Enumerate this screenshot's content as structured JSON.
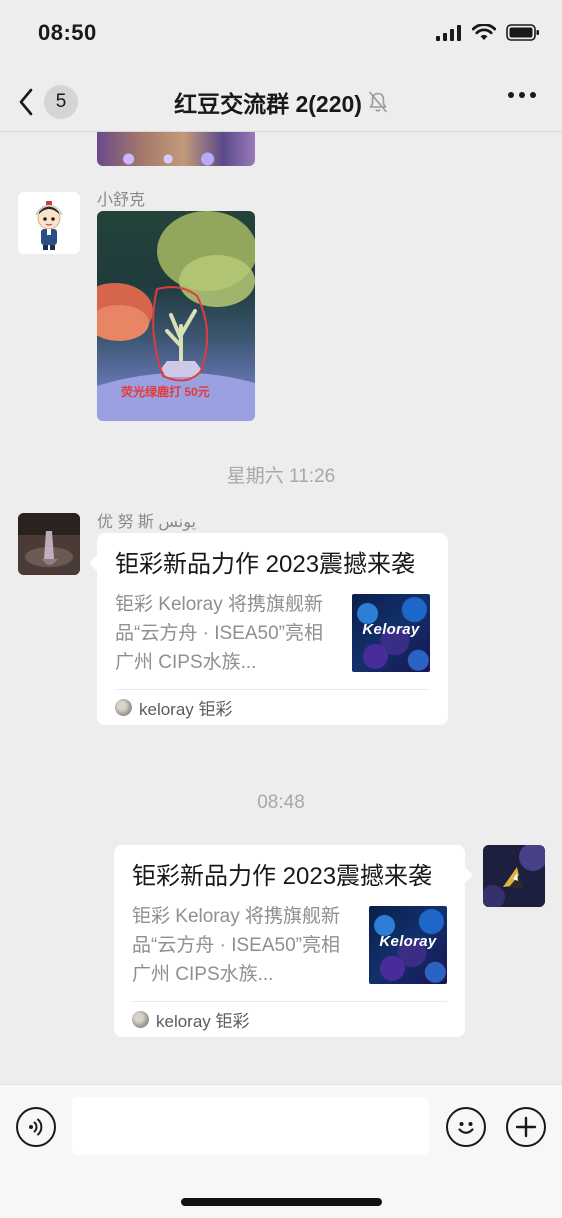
{
  "status_bar": {
    "time": "08:50"
  },
  "nav": {
    "unread_count": "5",
    "title": "红豆交流群 2(220)"
  },
  "messages": {
    "msg1": {
      "sender": "小舒克",
      "image_caption": "荧光绿鹿打 50元"
    },
    "divider1": "星期六 11:26",
    "msg2": {
      "sender": "优 努 斯  يونس",
      "card": {
        "title": "钜彩新品力作 2023震撼来袭",
        "desc": "钜彩 Keloray 将携旗舰新品“云方舟 · ISEA50”亮相广州 CIPS水族...",
        "thumb_text": "Keloray",
        "source": "keloray 钜彩"
      }
    },
    "divider2": "08:48",
    "msg3": {
      "card": {
        "title": "钜彩新品力作 2023震撼来袭",
        "desc": "钜彩 Keloray 将携旗舰新品“云方舟 · ISEA50”亮相广州 CIPS水族...",
        "thumb_text": "Keloray",
        "source": "keloray 钜彩"
      }
    }
  },
  "input_bar": {
    "placeholder": ""
  },
  "colors": {
    "background": "#ededed",
    "bubble": "#ffffff",
    "caption_red": "#e83838"
  }
}
